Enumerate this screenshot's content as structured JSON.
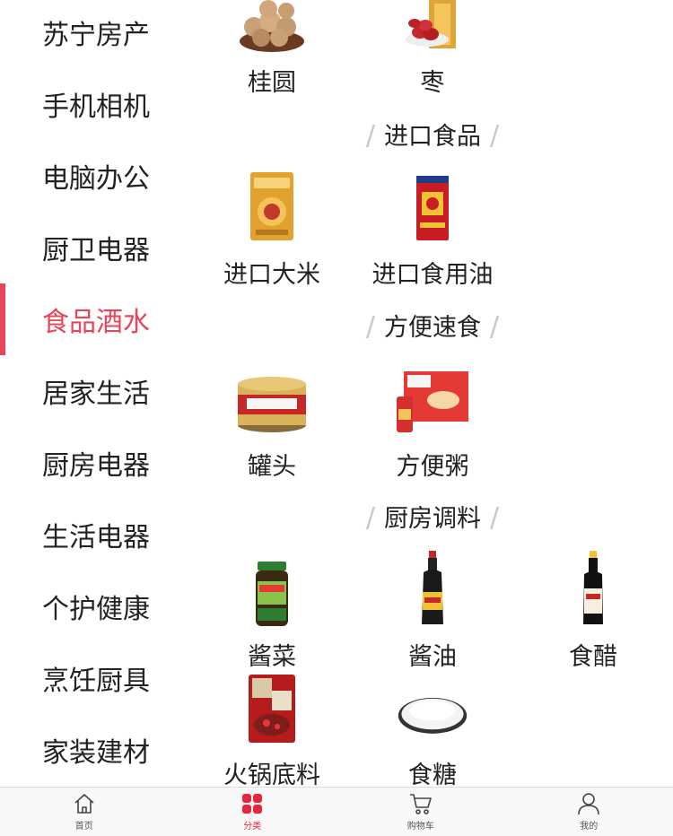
{
  "sidebar": {
    "items": [
      {
        "label": "苏宁房产"
      },
      {
        "label": "手机相机"
      },
      {
        "label": "电脑办公"
      },
      {
        "label": "厨卫电器"
      },
      {
        "label": "食品酒水"
      },
      {
        "label": "居家生活"
      },
      {
        "label": "厨房电器"
      },
      {
        "label": "生活电器"
      },
      {
        "label": "个护健康"
      },
      {
        "label": "烹饪厨具"
      },
      {
        "label": "家装建材"
      }
    ],
    "active_index": 4
  },
  "sections": {
    "imported": {
      "title": "进口食品"
    },
    "instant": {
      "title": "方便速食"
    },
    "seasoning": {
      "title": "厨房调料"
    }
  },
  "products": {
    "longan": "桂圆",
    "jujube": "枣",
    "rice": "进口大米",
    "oil": "进口食用油",
    "canned": "罐头",
    "porridge": "方便粥",
    "pickles": "酱菜",
    "soy_sauce": "酱油",
    "vinegar": "食醋",
    "hotpot_base": "火锅底料",
    "sugar": "食糖"
  },
  "tabbar": {
    "home": "首页",
    "category": "分类",
    "cart": "购物车",
    "mine": "我的"
  },
  "colors": {
    "accent": "#e9455a",
    "tab_active": "#e9243f"
  }
}
